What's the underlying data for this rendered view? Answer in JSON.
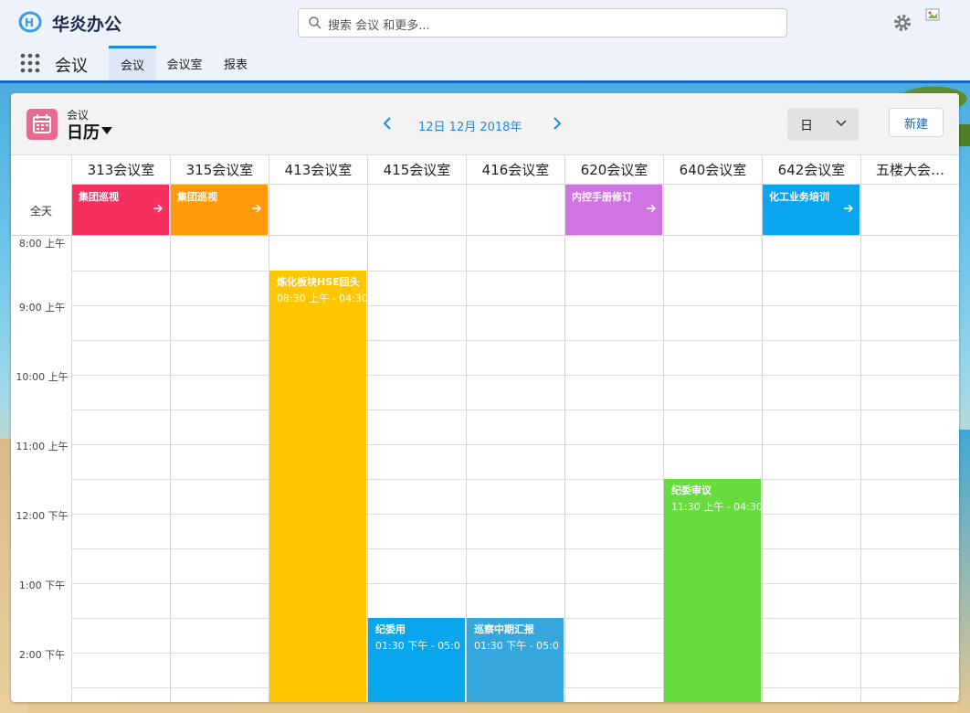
{
  "app": {
    "name": "华炎办公",
    "search_placeholder": "搜索 会议 和更多...",
    "avatar_alt": "头像"
  },
  "nav": {
    "app_label": "会议",
    "tabs": [
      {
        "label": "会议",
        "active": true
      },
      {
        "label": "会议室",
        "active": false
      },
      {
        "label": "报表",
        "active": false
      }
    ]
  },
  "header": {
    "object_label": "会议",
    "view_title": "日历",
    "date_label": "12日 12月 2018年",
    "view_mode": "日",
    "new_button": "新建"
  },
  "grid": {
    "allday_label": "全天",
    "rooms": [
      "313会议室",
      "315会议室",
      "413会议室",
      "415会议室",
      "416会议室",
      "620会议室",
      "640会议室",
      "642会议室",
      "五楼大会…"
    ],
    "time_labels": [
      "8:00 上午",
      "9:00 上午",
      "10:00 上午",
      "11:00 上午",
      "12:00 下午",
      "1:00 下午",
      "2:00 下午"
    ]
  },
  "allday_events": [
    {
      "room": 0,
      "title": "集团巡视",
      "color": "#f5305e"
    },
    {
      "room": 1,
      "title": "集团巡视",
      "color": "#ff9a0a"
    },
    {
      "room": 5,
      "title": "内控手册修订",
      "color": "#cf74e0"
    },
    {
      "room": 7,
      "title": "化工业务培训",
      "color": "#0aa6ed"
    }
  ],
  "events": [
    {
      "room": 2,
      "title": "炼化板块HSE回头",
      "time": "08:30 上午 - 04:30",
      "color": "#ffc700"
    },
    {
      "room": 3,
      "title": "纪委用",
      "time": "01:30 下午 - 05:0",
      "color": "#0aa6ed"
    },
    {
      "room": 4,
      "title": "巡察中期汇报",
      "time": "01:30 下午 - 05:0",
      "color": "#36a7dc"
    },
    {
      "room": 6,
      "title": "纪委审议",
      "time": "11:30 上午 - 04:30",
      "color": "#67dd3d"
    }
  ],
  "colors": {
    "accent": "#1e88e5",
    "calendar_icon": "#e66b8e"
  }
}
